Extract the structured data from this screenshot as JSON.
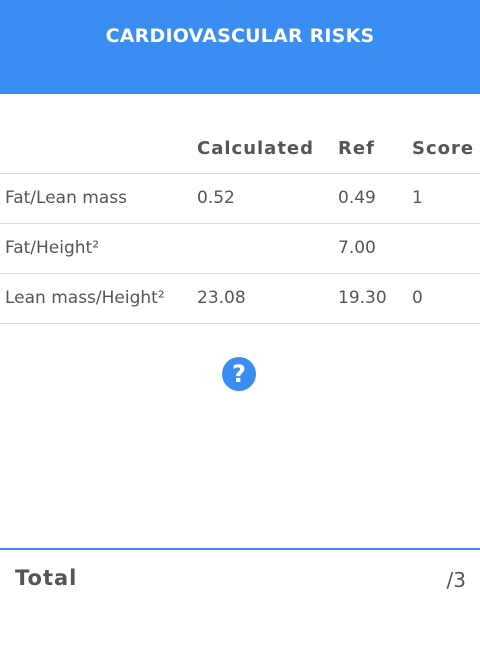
{
  "header": {
    "title": "CARDIOVASCULAR RISKS"
  },
  "table": {
    "columns": {
      "calculated": "Calculated",
      "ref": "Ref",
      "score": "Score"
    },
    "rows": [
      {
        "label": "Fat/Lean mass",
        "calculated": "0.52",
        "ref": "0.49",
        "score": "1"
      },
      {
        "label": "Fat/Height²",
        "calculated": "",
        "ref": "7.00",
        "score": ""
      },
      {
        "label": "Lean mass/Height²",
        "calculated": "23.08",
        "ref": "19.30",
        "score": "0"
      }
    ]
  },
  "help": {
    "icon": "question-circle-icon",
    "glyph": "?"
  },
  "total": {
    "label": "Total",
    "value": "/3"
  },
  "colors": {
    "accent": "#3a8ef1",
    "text": "#555555",
    "divider": "#dddddd"
  }
}
